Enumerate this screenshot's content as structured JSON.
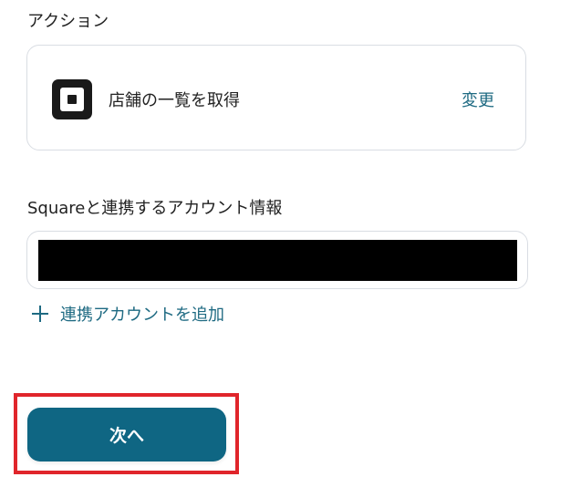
{
  "action_section": {
    "label": "アクション",
    "card": {
      "service_icon": "square-logo-icon",
      "action_name": "店舗の一覧を取得",
      "change_label": "変更"
    }
  },
  "account_section": {
    "label": "Squareと連携するアカウント情報",
    "selected_account": "",
    "add_account_label": "連携アカウントを追加"
  },
  "footer": {
    "next_label": "次へ"
  },
  "colors": {
    "accent": "#1e6a82",
    "button_bg": "#0f6683",
    "highlight": "#e0252b",
    "border": "#d9dde3"
  }
}
